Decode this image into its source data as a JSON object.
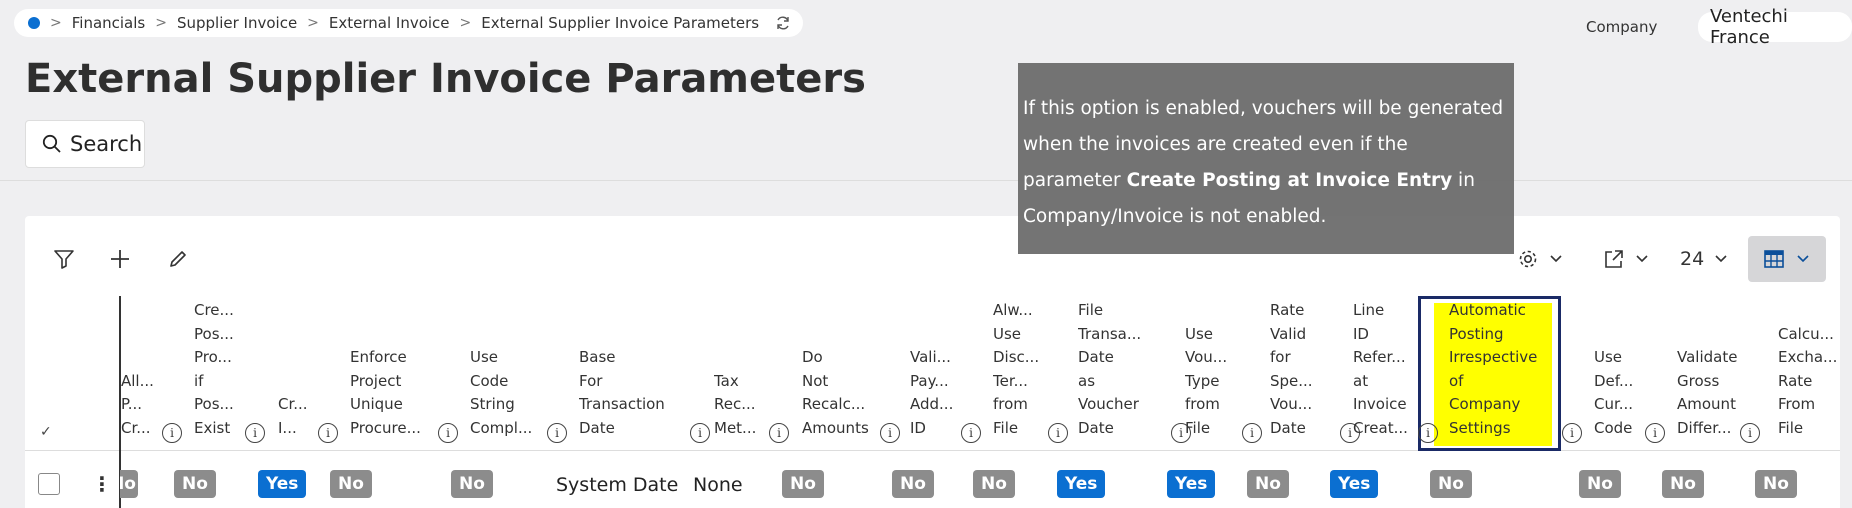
{
  "breadcrumb": {
    "items": [
      "Financials",
      "Supplier Invoice",
      "External Invoice",
      "External Supplier Invoice Parameters"
    ]
  },
  "company": {
    "label": "Company",
    "value": "Ventechi France"
  },
  "page": {
    "title": "External Supplier Invoice Parameters"
  },
  "search": {
    "label": "Search"
  },
  "toolbar": {
    "page_size": "24"
  },
  "tooltip": {
    "text_before": "If this option is enabled, vouchers will be generated when the invoices are created even if the parameter ",
    "bold": "Create Posting at Invoice Entry",
    "text_after": " in Company/Invoice is not enabled."
  },
  "columns": [
    {
      "label": "All... P... Cr..."
    },
    {
      "label": "Cre... Pos... Pro... if Pos... Exist"
    },
    {
      "label": "Cr... I..."
    },
    {
      "label": "Enforce Project Unique Procure..."
    },
    {
      "label": "Use Code String Compl..."
    },
    {
      "label": "Base For Transaction Date"
    },
    {
      "label": "Tax Rec... Met..."
    },
    {
      "label": "Do Not Recalc... Amounts"
    },
    {
      "label": "Vali... Pay... Add... ID"
    },
    {
      "label": "Alw... Use Disc... Ter... from File"
    },
    {
      "label": "Use File Transa... Date as Voucher Date"
    },
    {
      "label": "Use Vou... Type from File"
    },
    {
      "label": "Rate Valid for Spe... Vou... Date"
    },
    {
      "label": "Use Line ID Refer... at Invoice Creat..."
    },
    {
      "label": "Automatic Posting Irrespective of Company Settings"
    },
    {
      "label": "Use Def... Cur... Code"
    },
    {
      "label": "Validate Gross Amount Differ..."
    },
    {
      "label": "Calcu... Excha... Rate From File"
    }
  ],
  "row": {
    "values": [
      "No",
      "No",
      "Yes",
      "No",
      "No",
      "System Date",
      "None",
      "No",
      "No",
      "No",
      "Yes",
      "Yes",
      "No",
      "Yes",
      "No",
      "No",
      "No",
      "No"
    ]
  },
  "ghost_headers": [
    "Use",
    "Posting Irrespective of",
    "Use Def...",
    "Validate Gross",
    "Exch... Rate"
  ],
  "colors": {
    "accent": "#0b6fd1",
    "highlight": "#ffff00",
    "badge_no": "#8c8c8c"
  }
}
